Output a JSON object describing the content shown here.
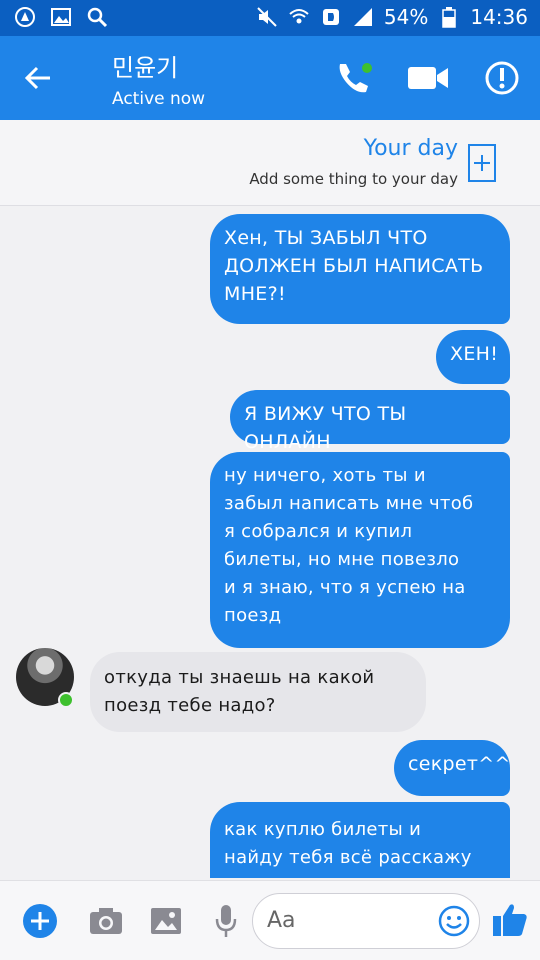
{
  "status_bar": {
    "battery": "54%",
    "time": "14:36",
    "colors": {
      "bg": "#0b5fc1"
    }
  },
  "header": {
    "contact_name": "민윤기",
    "contact_status": "Active now",
    "icons": [
      "back-arrow-icon",
      "phone-icon",
      "video-icon",
      "info-icon"
    ],
    "color": "#1f84e8"
  },
  "your_day": {
    "title": "Your day",
    "subtitle": "Add some thing to your day"
  },
  "messages": [
    {
      "dir": "out",
      "lines": [
        "Хен, ТЫ ЗАБЫЛ ЧТО",
        "ДОЛЖЕН БЫЛ НАПИСАТЬ",
        "МНЕ?!"
      ]
    },
    {
      "dir": "out",
      "lines": [
        "ХЕН!"
      ]
    },
    {
      "dir": "out",
      "lines": [
        "Я ВИЖУ ЧТО ТЫ ОНЛАЙН"
      ]
    },
    {
      "dir": "out",
      "lines": [
        "ну ничего, хоть ты и",
        "забыл написать мне чтоб",
        "я собрался и купил",
        "билеты, но мне повезло",
        "и я знаю, что я успею на",
        "поезд"
      ]
    },
    {
      "dir": "in",
      "lines": [
        "откуда ты знаешь на какой",
        "поезд тебе надо?"
      ]
    },
    {
      "dir": "out",
      "lines": [
        "секрет^^"
      ]
    },
    {
      "dir": "out",
      "lines": [
        "как куплю билеты и",
        "найду тебя всё расскажу"
      ]
    }
  ],
  "composer": {
    "placeholder": "Aa",
    "icons": [
      "plus-icon",
      "camera-icon",
      "gallery-icon",
      "mic-icon",
      "emoji-icon",
      "like-icon"
    ]
  }
}
